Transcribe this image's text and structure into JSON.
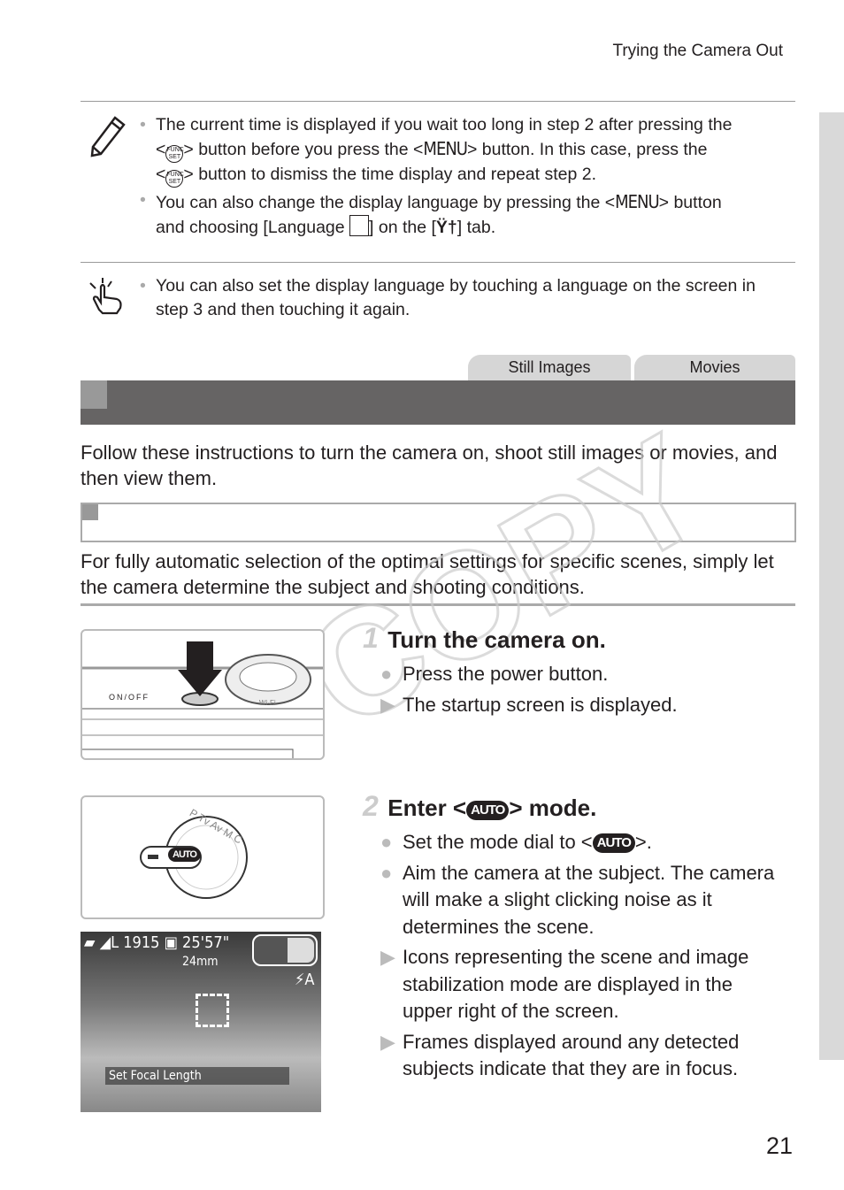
{
  "header": {
    "section": "Trying the Camera Out"
  },
  "note_pencil": {
    "icon": "pencil-icon",
    "items": [
      {
        "a": "The current time is displayed if you wait too long in step 2 after pressing the",
        "b": "<",
        "func": "FUNC SET",
        "c": "> button before you press the <",
        "menu": "MENU",
        "d": "> button. In this case, press the",
        "e": "<",
        "f": "> button to dismiss the time display and repeat step 2."
      },
      {
        "a": "You can also change the display language by pressing the <",
        "menu": "MENU",
        "b": "> button",
        "c": "and choosing [Language",
        "d": "] on the [",
        "e": "] tab."
      }
    ]
  },
  "note_touch": {
    "icon": "touch-icon",
    "text": "You can also set the display language by touching a language on the screen in step 3 and then touching it again."
  },
  "tabs": [
    "Still Images",
    "Movies"
  ],
  "intro": "Follow these instructions to turn the camera on, shoot still images or movies, and then view them.",
  "sub_intro": "For fully automatic selection of the optimal settings for specific scenes, simply let the camera determine the subject and shooting conditions.",
  "watermark": "COPY",
  "steps": [
    {
      "num": "1",
      "title": "Turn the camera on.",
      "items": [
        {
          "marker": "●",
          "text": "Press the power button."
        },
        {
          "marker": "▶",
          "text": "The startup screen is displayed."
        }
      ],
      "illustration": {
        "power_label": "ON/OFF",
        "wifi_label": "Wi-Fi"
      }
    },
    {
      "num": "2",
      "title_a": "Enter <",
      "title_auto": "AUTO",
      "title_b": "> mode.",
      "items": [
        {
          "marker": "●",
          "text_a": "Set the mode dial to <",
          "auto": "AUTO",
          "text_b": ">."
        },
        {
          "marker": "●",
          "text": "Aim the camera at the subject. The camera will make a slight clicking noise as it determines the scene."
        },
        {
          "marker": "▶",
          "text": "Icons representing the scene and image stabilization mode are displayed in the upper right of the screen."
        },
        {
          "marker": "▶",
          "text": "Frames displayed around any detected subjects indicate that they are in focus."
        }
      ],
      "dial": {
        "labels": "P Tv Av M C",
        "selected": "AUTO"
      },
      "screen": {
        "shots": "1915",
        "quality": "L",
        "movie_time": "25'57\"",
        "focal": "24mm",
        "hint": "Set Focal Length",
        "flash": "⚡A"
      }
    }
  ],
  "page_number": "21"
}
